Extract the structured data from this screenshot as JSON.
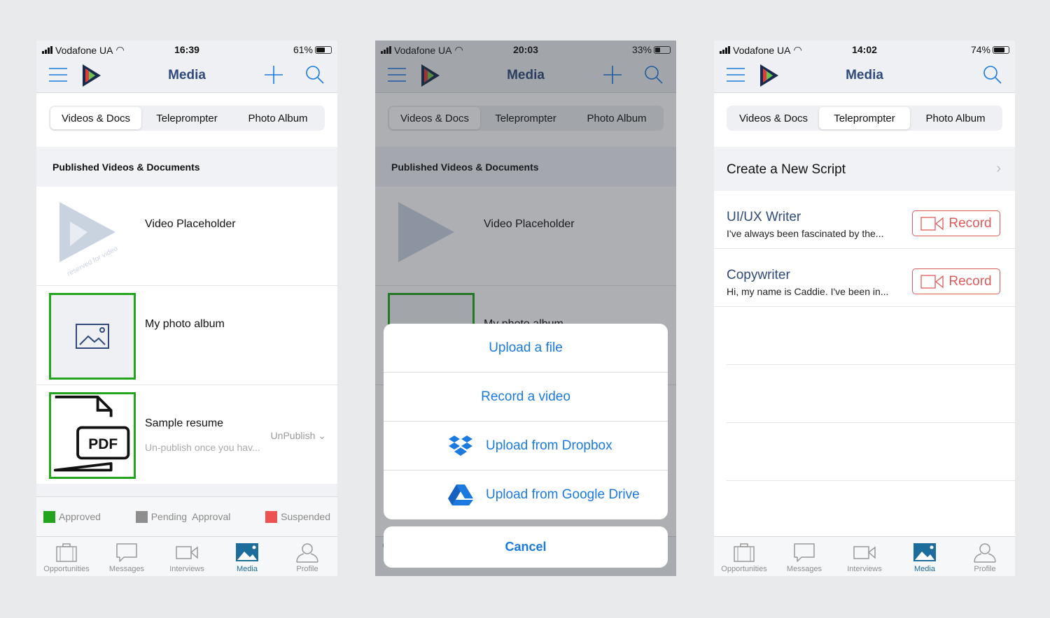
{
  "colors": {
    "accent": "#1a7ae0",
    "title": "#2f4a7a",
    "approved": "#22a51c",
    "pending": "#8e8e8e",
    "suspended": "#ec5252",
    "record": "#e05a5a",
    "tab_active": "#1c6c9c"
  },
  "screens": [
    {
      "status": {
        "carrier": "Vodafone UA",
        "time": "16:39",
        "battery": "61%",
        "battery_level": 61
      },
      "nav": {
        "title": "Media"
      },
      "segments": [
        "Videos & Docs",
        "Teleprompter",
        "Photo Album"
      ],
      "selected_segment": 0,
      "section": "Published Videos & Documents",
      "items": [
        {
          "name": "Video Placeholder",
          "thumb_text": "reserved for video"
        },
        {
          "name": "My photo album"
        },
        {
          "name": "Sample resume",
          "subtitle": "Un-publish once you hav...",
          "action": "UnPublish",
          "thumb_text": "PDF"
        }
      ],
      "legend": [
        "Approved",
        "Pending  Approval",
        "Suspended"
      ]
    },
    {
      "status": {
        "carrier": "Vodafone UA",
        "time": "20:03",
        "battery": "33%",
        "battery_level": 33
      },
      "nav": {
        "title": "Media"
      },
      "segments": [
        "Videos & Docs",
        "Teleprompter",
        "Photo Album"
      ],
      "section": "Published Videos & Documents",
      "items": [
        {
          "name": "Video Placeholder"
        },
        {
          "name": "My photo album"
        }
      ],
      "sheet": [
        "Upload a file",
        "Record a video",
        "Upload from Dropbox",
        "Upload from Google Drive"
      ],
      "cancel": "Cancel"
    },
    {
      "status": {
        "carrier": "Vodafone UA",
        "time": "14:02",
        "battery": "74%",
        "battery_level": 74
      },
      "nav": {
        "title": "Media"
      },
      "segments": [
        "Videos & Docs",
        "Teleprompter",
        "Photo Album"
      ],
      "selected_segment": 1,
      "create": "Create a New Script",
      "scripts": [
        {
          "title": "UI/UX Writer",
          "desc": "I've always been fascinated by the...",
          "button": "Record"
        },
        {
          "title": "Copywriter",
          "desc": "Hi, my name is Caddie. I've been in...",
          "button": "Record"
        }
      ]
    }
  ],
  "tabbar": [
    {
      "label": "Opportunities",
      "icon": "briefcase-icon"
    },
    {
      "label": "Messages",
      "icon": "chat-bubble-icon"
    },
    {
      "label": "Interviews",
      "icon": "video-camera-icon"
    },
    {
      "label": "Media",
      "icon": "image-icon",
      "active": true
    },
    {
      "label": "Profile",
      "icon": "user-icon"
    }
  ]
}
